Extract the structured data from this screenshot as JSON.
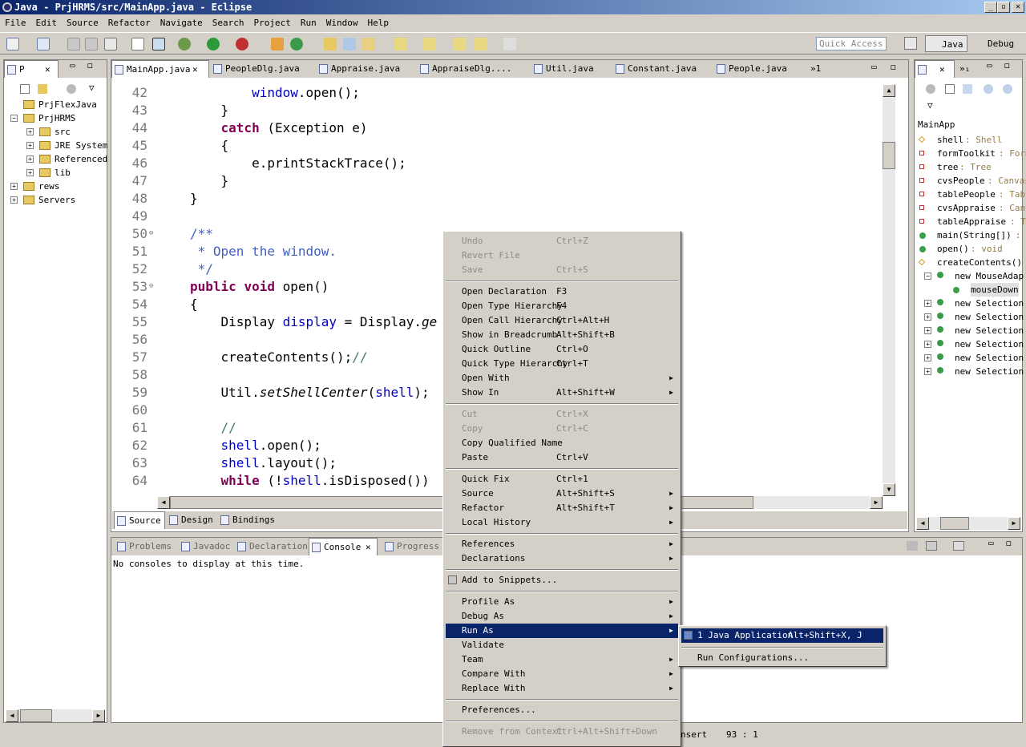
{
  "window": {
    "title": "Java - PrjHRMS/src/MainApp.java - Eclipse",
    "minimize": "_",
    "maximize": "▫",
    "close": "✕"
  },
  "menu": [
    "File",
    "Edit",
    "Source",
    "Refactor",
    "Navigate",
    "Search",
    "Project",
    "Run",
    "Window",
    "Help"
  ],
  "toolbar": {
    "quick_access_placeholder": "Quick Access",
    "perspective_java": "Java",
    "perspective_debug": "Debug"
  },
  "explorer": {
    "tab_label": "P",
    "items": [
      {
        "label": "PrjFlexJava",
        "level": 0,
        "expand": ""
      },
      {
        "label": "PrjHRMS",
        "level": 0,
        "expand": "−"
      },
      {
        "label": "src",
        "level": 1,
        "expand": "+"
      },
      {
        "label": "JRE System",
        "level": 1,
        "expand": "+"
      },
      {
        "label": "Referenced",
        "level": 1,
        "expand": "+"
      },
      {
        "label": "lib",
        "level": 1,
        "expand": "+"
      },
      {
        "label": "rews",
        "level": 0,
        "expand": "+"
      },
      {
        "label": "Servers",
        "level": 0,
        "expand": "+"
      }
    ]
  },
  "editor_tabs": [
    "MainApp.java",
    "PeopleDlg.java",
    "Appraise.java",
    "AppraiseDlg....",
    "Util.java",
    "Constant.java",
    "People.java"
  ],
  "editor_more": "»1",
  "code": {
    "lines": [
      {
        "n": "42",
        "t": "        window.open();"
      },
      {
        "n": "43",
        "t": "    }"
      },
      {
        "n": "44",
        "t": "    catch (Exception e)"
      },
      {
        "n": "45",
        "t": "    {"
      },
      {
        "n": "46",
        "t": "        e.printStackTrace();"
      },
      {
        "n": "47",
        "t": "    }"
      },
      {
        "n": "48",
        "t": "}"
      },
      {
        "n": "49",
        "t": ""
      },
      {
        "n": "50",
        "t": "/**"
      },
      {
        "n": "51",
        "t": " * Open the window."
      },
      {
        "n": "52",
        "t": " */"
      },
      {
        "n": "53",
        "t": "public void open()"
      },
      {
        "n": "54",
        "t": "{"
      },
      {
        "n": "55",
        "t": "    Display display = Display.ge"
      },
      {
        "n": "56",
        "t": ""
      },
      {
        "n": "57",
        "t": "    createContents();//"
      },
      {
        "n": "58",
        "t": ""
      },
      {
        "n": "59",
        "t": "    Util.setShellCenter(shell);"
      },
      {
        "n": "60",
        "t": ""
      },
      {
        "n": "61",
        "t": "    //"
      },
      {
        "n": "62",
        "t": "    shell.open();"
      },
      {
        "n": "63",
        "t": "    shell.layout();"
      },
      {
        "n": "64",
        "t": "    while (!shell.isDisposed())"
      }
    ]
  },
  "editor_bottom_tabs": [
    "Source",
    "Design",
    "Bindings"
  ],
  "console": {
    "tabs": [
      "Problems",
      "Javadoc",
      "Declaration",
      "Console",
      "Progress"
    ],
    "message": "No consoles to display at this time."
  },
  "status": {
    "insert": "nsert",
    "position": "93 : 1"
  },
  "outline": {
    "root": "MainApp",
    "items": [
      {
        "label": "shell",
        "type": " : Shell",
        "kind": "diamond"
      },
      {
        "label": "formToolkit",
        "type": " : Form",
        "kind": "sq"
      },
      {
        "label": "tree",
        "type": " : Tree",
        "kind": "sq"
      },
      {
        "label": "cvsPeople",
        "type": " : Canvas",
        "kind": "sq"
      },
      {
        "label": "tablePeople",
        "type": " : Tabl",
        "kind": "sq"
      },
      {
        "label": "cvsAppraise",
        "type": " : Canv",
        "kind": "sq"
      },
      {
        "label": "tableAppraise",
        "type": " : T",
        "kind": "sq"
      },
      {
        "label": "main(String[])",
        "type": " : v",
        "kind": "green"
      },
      {
        "label": "open()",
        "type": " : void",
        "kind": "green"
      },
      {
        "label": "createContents()",
        "type": "",
        "kind": "diamond"
      },
      {
        "label": "new MouseAdap",
        "type": "",
        "kind": "class"
      },
      {
        "label": "mouseDown",
        "type": "",
        "kind": "green"
      },
      {
        "label": "new Selection",
        "type": "",
        "kind": "class"
      },
      {
        "label": "new Selection",
        "type": "",
        "kind": "class"
      },
      {
        "label": "new Selection",
        "type": "",
        "kind": "class"
      },
      {
        "label": "new Selection",
        "type": "",
        "kind": "class"
      },
      {
        "label": "new Selection",
        "type": "",
        "kind": "class"
      },
      {
        "label": "new Selection",
        "type": "",
        "kind": "class"
      }
    ]
  },
  "context_menu": {
    "items": [
      {
        "label": "Undo",
        "shortcut": "Ctrl+Z",
        "disabled": true
      },
      {
        "label": "Revert File",
        "shortcut": "",
        "disabled": true
      },
      {
        "label": "Save",
        "shortcut": "Ctrl+S",
        "disabled": true
      },
      {
        "sep": true
      },
      {
        "label": "Open Declaration",
        "shortcut": "F3"
      },
      {
        "label": "Open Type Hierarchy",
        "shortcut": "F4"
      },
      {
        "label": "Open Call Hierarchy",
        "shortcut": "Ctrl+Alt+H"
      },
      {
        "label": "Show in Breadcrumb",
        "shortcut": "Alt+Shift+B"
      },
      {
        "label": "Quick Outline",
        "shortcut": "Ctrl+O"
      },
      {
        "label": "Quick Type Hierarchy",
        "shortcut": "Ctrl+T"
      },
      {
        "label": "Open With",
        "shortcut": "",
        "sub": true
      },
      {
        "label": "Show In",
        "shortcut": "Alt+Shift+W",
        "sub": true
      },
      {
        "sep": true
      },
      {
        "label": "Cut",
        "shortcut": "Ctrl+X",
        "disabled": true
      },
      {
        "label": "Copy",
        "shortcut": "Ctrl+C",
        "disabled": true
      },
      {
        "label": "Copy Qualified Name",
        "shortcut": ""
      },
      {
        "label": "Paste",
        "shortcut": "Ctrl+V"
      },
      {
        "sep": true
      },
      {
        "label": "Quick Fix",
        "shortcut": "Ctrl+1"
      },
      {
        "label": "Source",
        "shortcut": "Alt+Shift+S",
        "sub": true
      },
      {
        "label": "Refactor",
        "shortcut": "Alt+Shift+T",
        "sub": true
      },
      {
        "label": "Local History",
        "shortcut": "",
        "sub": true
      },
      {
        "sep": true
      },
      {
        "label": "References",
        "shortcut": "",
        "sub": true
      },
      {
        "label": "Declarations",
        "shortcut": "",
        "sub": true
      },
      {
        "sep": true
      },
      {
        "label": "Add to Snippets...",
        "shortcut": ""
      },
      {
        "sep": true
      },
      {
        "label": "Profile As",
        "shortcut": "",
        "sub": true
      },
      {
        "label": "Debug As",
        "shortcut": "",
        "sub": true
      },
      {
        "label": "Run As",
        "shortcut": "",
        "sub": true,
        "selected": true
      },
      {
        "label": "Validate",
        "shortcut": ""
      },
      {
        "label": "Team",
        "shortcut": "",
        "sub": true
      },
      {
        "label": "Compare With",
        "shortcut": "",
        "sub": true
      },
      {
        "label": "Replace With",
        "shortcut": "",
        "sub": true
      },
      {
        "sep": true
      },
      {
        "label": "Preferences...",
        "shortcut": ""
      },
      {
        "sep": true
      },
      {
        "label": "Remove from Context",
        "shortcut": "Ctrl+Alt+Shift+Down",
        "disabled": true
      }
    ]
  },
  "submenu": {
    "items": [
      {
        "label": "1 Java Application",
        "shortcut": "Alt+Shift+X, J",
        "selected": true
      },
      {
        "sep": true
      },
      {
        "label": "Run Configurations...",
        "shortcut": ""
      }
    ]
  },
  "colors": {
    "keyword": "#7f0055",
    "field": "#0000c0",
    "comment": "#3f5fbf",
    "selection": "#0a246a"
  }
}
